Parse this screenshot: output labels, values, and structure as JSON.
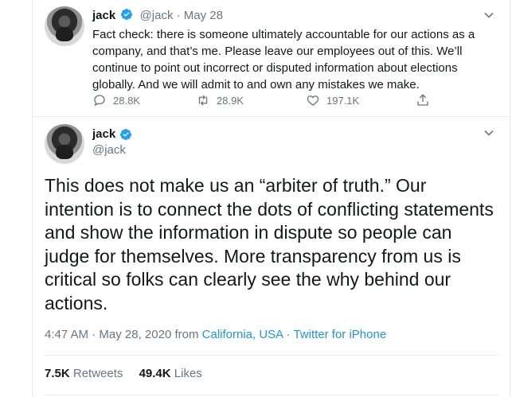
{
  "tweet1": {
    "name": "jack",
    "handle": "@jack",
    "separator": "·",
    "date": "May 28",
    "text": "Fact check: there is someone ultimately accountable for our actions as a company, and that’s me. Please leave our employees out of this. We’ll continue to point out incorrect or disputed information about elections globally. And we will admit to and own any mistakes we make.",
    "reply_count": "28.8K",
    "retweet_count": "28.9K",
    "like_count": "197.1K",
    "icons": [
      "reply-icon",
      "retweet-icon",
      "like-icon",
      "share-icon",
      "chevron-down-icon",
      "verified-icon"
    ]
  },
  "tweet2": {
    "name": "jack",
    "handle": "@jack",
    "text": "This does not make us an “arbiter of truth.” Our intention is to connect the dots of conflicting statements and show the information in dispute so people can judge for themselves. More transparency from us is critical so folks can clearly see the why behind our actions.",
    "time": "4:47 AM",
    "dot": "·",
    "date": "May 28, 2020",
    "from": "from",
    "location": "California, USA",
    "dot2": "·",
    "source": "Twitter for iPhone",
    "retweets_count": "7.5K",
    "retweets_label": "Retweets",
    "likes_count": "49.4K",
    "likes_label": "Likes"
  },
  "colors": {
    "text": "#14171a",
    "muted": "#657786",
    "link": "#1b95e0",
    "verified": "#1da1f2",
    "divider": "#e6ecf0"
  }
}
